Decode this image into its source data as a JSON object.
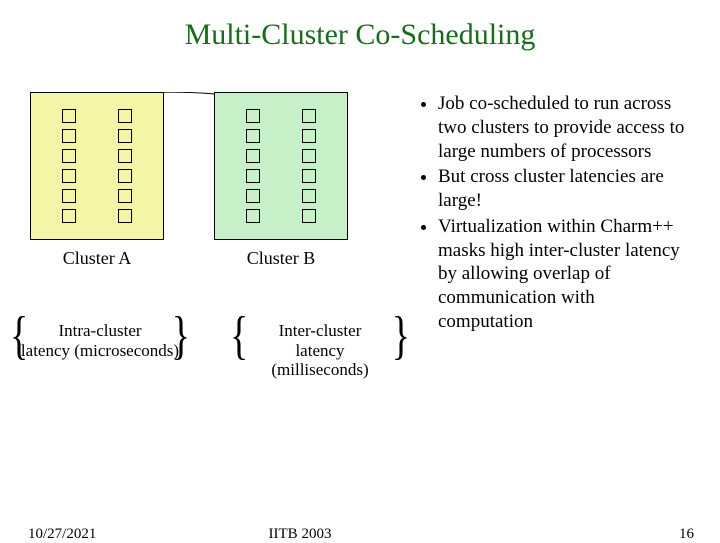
{
  "title": "Multi-Cluster Co-Scheduling",
  "clusters": {
    "a": {
      "label": "Cluster A"
    },
    "b": {
      "label": "Cluster B"
    }
  },
  "latency": {
    "intra": {
      "line1": "Intra-cluster",
      "line2": "latency (microseconds)"
    },
    "inter": {
      "line1": "Inter-cluster",
      "line2": "latency",
      "line3": "(milliseconds)"
    }
  },
  "bullets": [
    "Job co-scheduled to run across two clusters to provide access to large numbers of processors",
    "But cross cluster latencies are large!",
    "Virtualization within Charm++ masks high inter-cluster latency by allowing overlap of communication with computation"
  ],
  "footer": {
    "date": "10/27/2021",
    "center": "IITB 2003",
    "page": "16"
  }
}
